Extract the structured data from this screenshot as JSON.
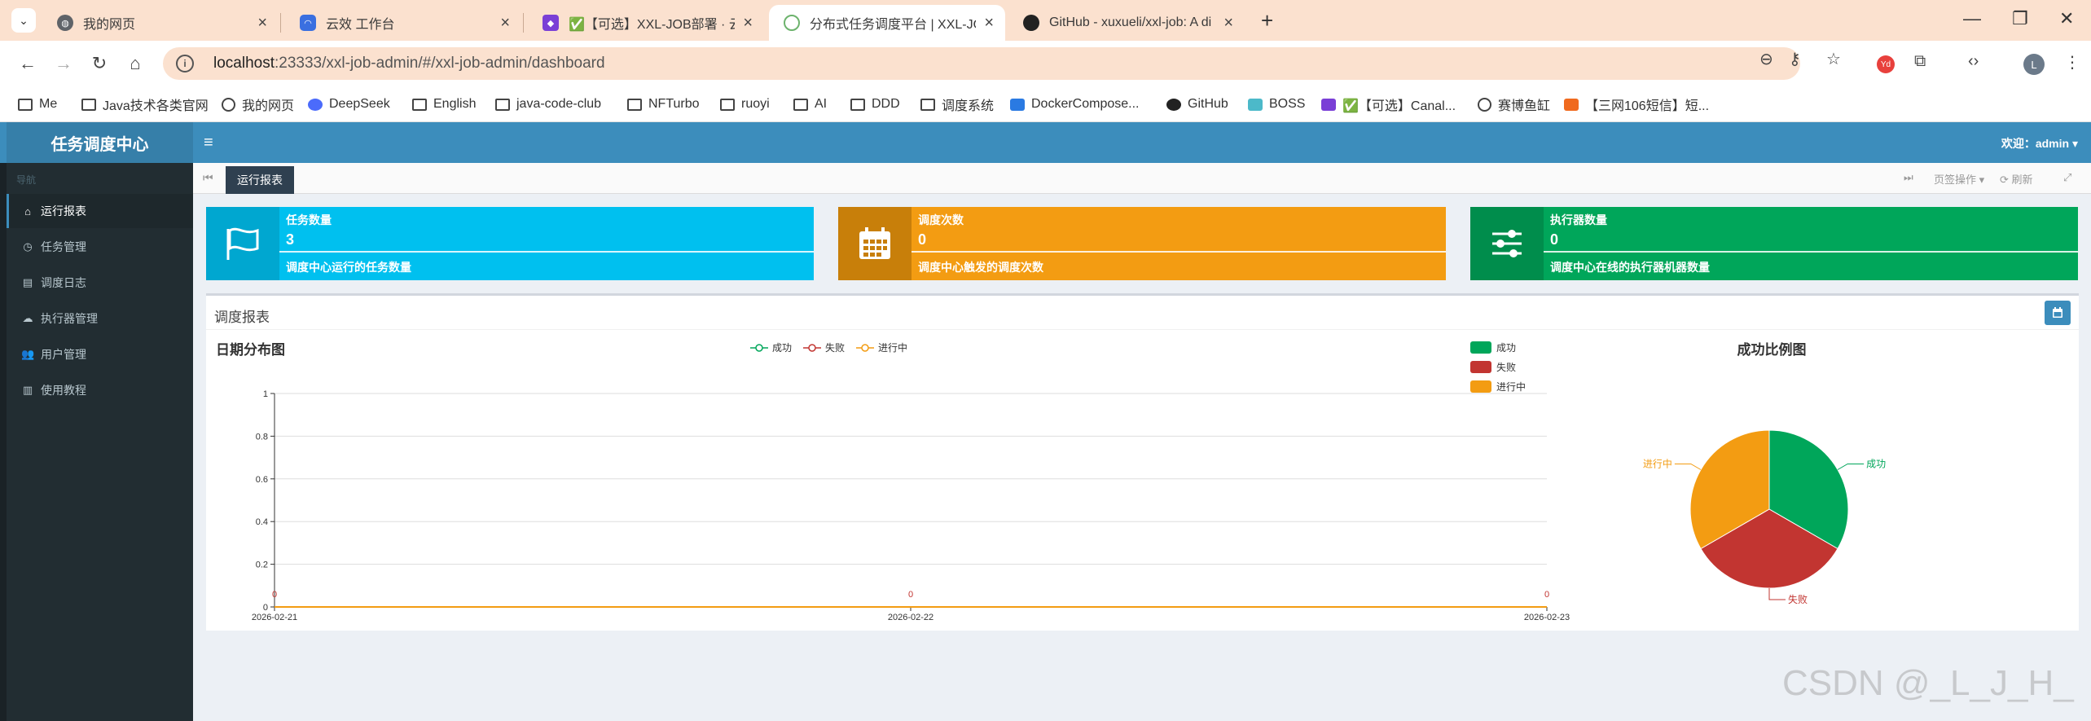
{
  "browser": {
    "tabs": [
      {
        "title": "我的网页",
        "active": false
      },
      {
        "title": "云效 工作台",
        "active": false
      },
      {
        "title": "✅【可选】XXL-JOB部署 · 云效",
        "active": false
      },
      {
        "title": "分布式任务调度平台 | XXL-JOB",
        "active": true
      },
      {
        "title": "GitHub - xuxueli/xxl-job: A di",
        "active": false
      }
    ],
    "url_host": "localhost",
    "url_rest": ":23333/xxl-job-admin/#/xxl-job-admin/dashboard",
    "profile_initial": "L",
    "bookmarks": [
      "Me",
      "Java技术各类官网",
      "我的网页",
      "DeepSeek",
      "English",
      "java-code-club",
      "NFTurbo",
      "ruoyi",
      "AI",
      "DDD",
      "调度系统",
      "DockerCompose...",
      "GitHub",
      "BOSS",
      "✅【可选】Canal...",
      "赛博鱼缸",
      "【三网106短信】短..."
    ]
  },
  "app": {
    "logo": "任务调度中心",
    "welcome": "欢迎：admin ▾",
    "nav_header": "导航",
    "nav": [
      {
        "label": "运行报表",
        "icon": "home-icon",
        "glyph": "⌂",
        "active": true
      },
      {
        "label": "任务管理",
        "icon": "clock-icon",
        "glyph": "◷",
        "active": false
      },
      {
        "label": "调度日志",
        "icon": "database-icon",
        "glyph": "▤",
        "active": false
      },
      {
        "label": "执行器管理",
        "icon": "cloud-icon",
        "glyph": "☁",
        "active": false
      },
      {
        "label": "用户管理",
        "icon": "users-icon",
        "glyph": "👥",
        "active": false
      },
      {
        "label": "使用教程",
        "icon": "book-icon",
        "glyph": "▥",
        "active": false
      }
    ],
    "page_tab": "运行报表",
    "tab_actions": {
      "page_ops": "页签操作 ▾",
      "refresh": "⟳ 刷新"
    },
    "info_boxes": [
      {
        "label": "任务数量",
        "value": "3",
        "desc": "调度中心运行的任务数量",
        "color": "#00c0ef",
        "icon_bg": "#00a7d0",
        "icon": "flag-icon"
      },
      {
        "label": "调度次数",
        "value": "0",
        "desc": "调度中心触发的调度次数",
        "color": "#f39c12",
        "icon_bg": "#c87f0a",
        "icon": "calendar-icon"
      },
      {
        "label": "执行器数量",
        "value": "0",
        "desc": "调度中心在线的执行器机器数量",
        "color": "#00a65a",
        "icon_bg": "#008d4c",
        "icon": "sliders-icon"
      }
    ],
    "report_title": "调度报表"
  },
  "chart_data": [
    {
      "type": "line",
      "title": "日期分布图",
      "x": [
        "2026-02-21",
        "2026-02-22",
        "2026-02-23"
      ],
      "series": [
        {
          "name": "成功",
          "values": [
            0,
            0,
            0
          ],
          "color": "#00a65a"
        },
        {
          "name": "失败",
          "values": [
            0,
            0,
            0
          ],
          "color": "#c23531"
        },
        {
          "name": "进行中",
          "values": [
            0,
            0,
            0
          ],
          "color": "#f39c12"
        }
      ],
      "ylim": [
        0,
        1
      ],
      "yticks": [
        0,
        0.2,
        0.4,
        0.6,
        0.8,
        1
      ],
      "point_labels": [
        "0",
        "0",
        "0"
      ],
      "grid": true,
      "legend": "top-center"
    },
    {
      "type": "pie",
      "title": "成功比例图",
      "labels": [
        "成功",
        "失败",
        "进行中"
      ],
      "values": [
        1,
        1,
        1
      ],
      "colors": [
        "#00a65a",
        "#c23531",
        "#f39c12"
      ],
      "legend": "top-left"
    }
  ],
  "watermark": "CSDN @_L_J_H_"
}
